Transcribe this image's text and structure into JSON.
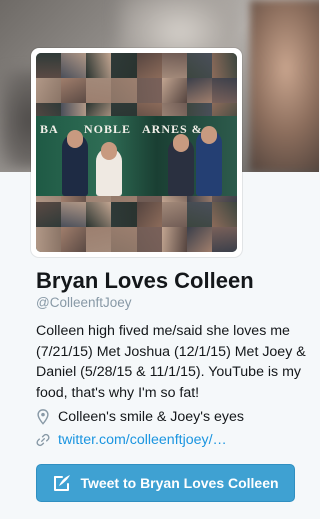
{
  "profile": {
    "name": "Bryan Loves Colleen",
    "screen_name": "@ColleenftJoey",
    "bio": "Colleen high fived me/said she loves me (7/21/15) Met Joshua (12/1/15) Met Joey & Daniel (5/28/15 & 11/1/15). YouTube is my food, that's why I'm so fat!",
    "location": "Colleen's smile & Joey's eyes",
    "url": "twitter.com/colleenftjoey/…",
    "avatar_store_text_left": "BA",
    "avatar_store_text_mid": "NOBLE",
    "avatar_store_text_right": "ARNES &"
  },
  "actions": {
    "tweet_button_label": "Tweet to Bryan Loves Colleen"
  },
  "icons": {
    "location": "map-pin-icon",
    "url": "link-icon",
    "tweet": "compose-tweet-icon"
  },
  "colors": {
    "link": "#1b95e0",
    "button": "#3fa1d2",
    "muted": "#8899a6",
    "text": "#14171a"
  }
}
